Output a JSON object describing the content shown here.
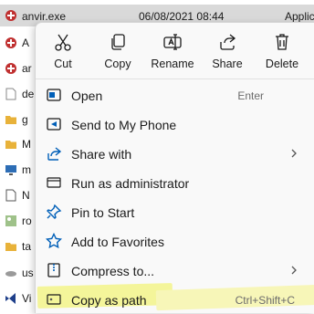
{
  "explorer": {
    "selected_row": {
      "name": "anvir.exe",
      "date": "06/08/2021 08:44",
      "type": "Applic"
    },
    "rows": [
      {
        "name": "A"
      },
      {
        "name": "ar"
      },
      {
        "name": "de"
      },
      {
        "name": "g"
      },
      {
        "name": "M"
      },
      {
        "name": "m"
      },
      {
        "name": "N"
      },
      {
        "name": "ro"
      },
      {
        "name": "ta"
      },
      {
        "name": "us"
      },
      {
        "name": "Vi"
      }
    ]
  },
  "context_menu": {
    "actions": [
      {
        "label": "Cut",
        "icon": "scissors-icon"
      },
      {
        "label": "Copy",
        "icon": "copy-icon"
      },
      {
        "label": "Rename",
        "icon": "rename-icon"
      },
      {
        "label": "Share",
        "icon": "share-icon"
      },
      {
        "label": "Delete",
        "icon": "trash-icon"
      }
    ],
    "items": [
      {
        "label": "Open",
        "shortcut": "Enter",
        "icon": "open-app-icon"
      },
      {
        "label": "Send to My Phone",
        "icon": "phone-send-icon"
      },
      {
        "label": "Share with",
        "icon": "share-with-icon",
        "submenu": true
      },
      {
        "label": "Run as administrator",
        "icon": "shield-icon"
      },
      {
        "label": "Pin to Start",
        "icon": "pin-icon"
      },
      {
        "label": "Add to Favorites",
        "icon": "star-icon"
      },
      {
        "label": "Compress to...",
        "icon": "zip-icon",
        "submenu": true
      },
      {
        "label": "Copy as path",
        "shortcut": "Ctrl+Shift+C",
        "icon": "copy-path-icon",
        "highlighted": true
      }
    ]
  },
  "colors": {
    "accent": "#005fb8",
    "highlight": "#f4f59a",
    "selected_row": "#d9d9d9"
  }
}
